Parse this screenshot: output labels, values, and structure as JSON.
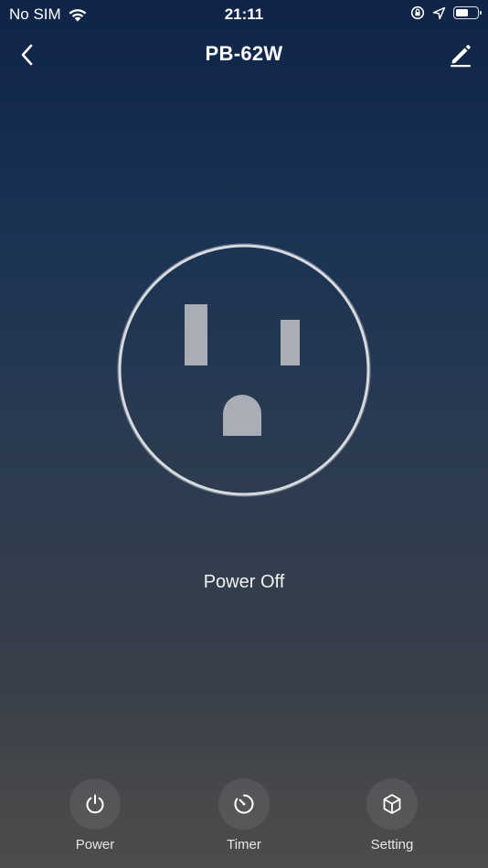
{
  "status_bar": {
    "carrier": "No SIM",
    "time": "21:11",
    "battery_level": 0.6
  },
  "header": {
    "title": "PB-62W"
  },
  "device": {
    "state_text": "Power Off"
  },
  "actions": [
    {
      "label": "Power"
    },
    {
      "label": "Timer"
    },
    {
      "label": "Setting"
    }
  ],
  "icons": {
    "back": "chevron-left-icon",
    "edit": "pencil-icon",
    "power": "power-icon",
    "timer": "timer-icon",
    "setting": "cube-icon"
  },
  "colors": {
    "outlet_face": "#a9aeb6",
    "ring": "#d6d9de"
  }
}
